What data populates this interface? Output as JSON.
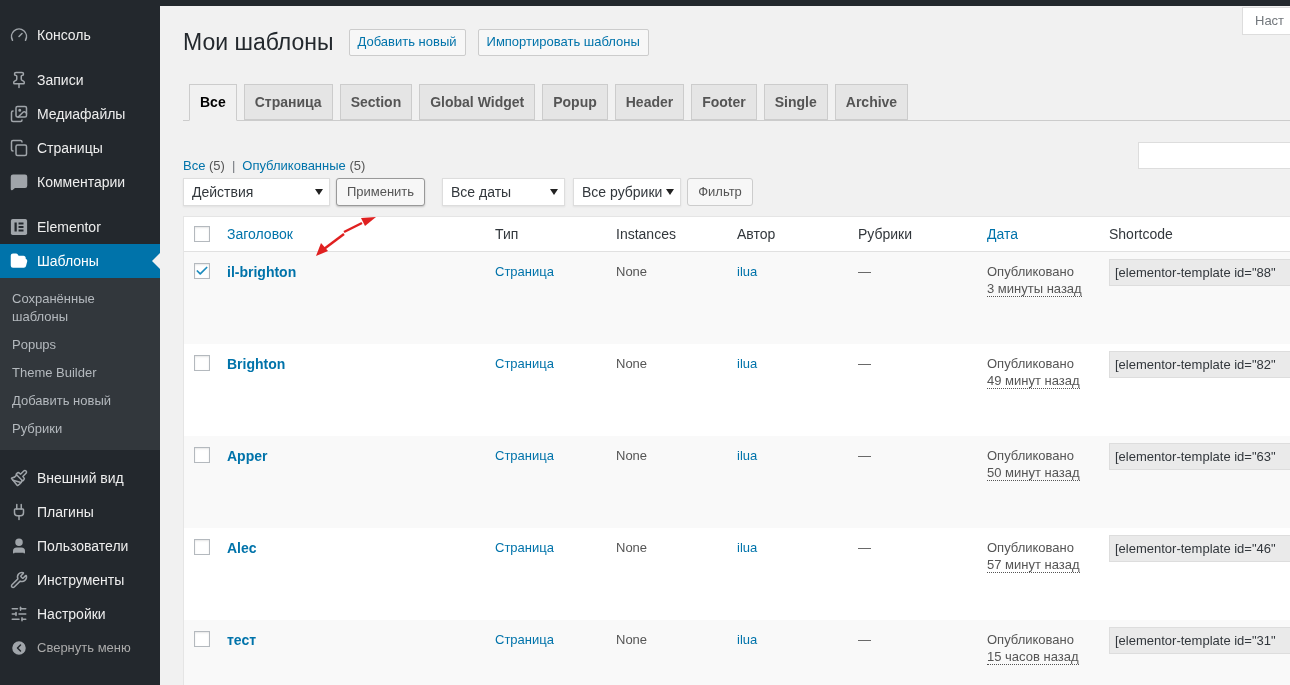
{
  "top_bar": {
    "screen_options": "Наст"
  },
  "sidebar": {
    "groups": [
      {
        "items": [
          {
            "label": "Консоль",
            "selected": false
          }
        ]
      },
      {
        "items": [
          {
            "label": "Записи",
            "selected": false
          },
          {
            "label": "Медиафайлы",
            "selected": false
          },
          {
            "label": "Страницы",
            "selected": false
          },
          {
            "label": "Комментарии",
            "selected": false
          }
        ]
      },
      {
        "items": [
          {
            "label": "Elementor",
            "selected": false
          },
          {
            "label": "Шаблоны",
            "selected": true,
            "children": [
              {
                "label": "Сохранённые шаблоны",
                "selected": false
              },
              {
                "label": "Popups",
                "selected": false
              },
              {
                "label": "Theme Builder",
                "selected": false
              },
              {
                "label": "Добавить новый",
                "selected": false
              },
              {
                "label": "Рубрики",
                "selected": false
              }
            ]
          }
        ]
      },
      {
        "items": [
          {
            "label": "Внешний вид",
            "selected": false
          },
          {
            "label": "Плагины",
            "selected": false
          },
          {
            "label": "Пользователи",
            "selected": false
          },
          {
            "label": "Инструменты",
            "selected": false
          },
          {
            "label": "Настройки",
            "selected": false
          }
        ]
      }
    ],
    "collapse": "Свернуть меню"
  },
  "page": {
    "title": "Мои шаблоны",
    "buttons": [
      "Добавить новый",
      "Импортировать шаблоны"
    ]
  },
  "tabs": [
    {
      "label": "Все",
      "selected": true
    },
    {
      "label": "Страница",
      "selected": false
    },
    {
      "label": "Section",
      "selected": false
    },
    {
      "label": "Global Widget",
      "selected": false
    },
    {
      "label": "Popup",
      "selected": false
    },
    {
      "label": "Header",
      "selected": false
    },
    {
      "label": "Footer",
      "selected": false
    },
    {
      "label": "Single",
      "selected": false
    },
    {
      "label": "Archive",
      "selected": false
    }
  ],
  "views": {
    "items": [
      {
        "label": "Все",
        "count": "(5)"
      },
      {
        "label": "Опубликованные",
        "count": "(5)"
      }
    ],
    "separator": "|"
  },
  "filters": {
    "bulk_action": "Действия",
    "apply": "Применить",
    "dates": "Все даты",
    "categories": "Все рубрики",
    "filter": "Фильтр"
  },
  "table": {
    "select_all_checked": false,
    "columns": [
      {
        "label": "Заголовок",
        "sortable": true
      },
      {
        "label": "Тип",
        "sortable": false
      },
      {
        "label": "Instances",
        "sortable": false
      },
      {
        "label": "Автор",
        "sortable": false
      },
      {
        "label": "Рубрики",
        "sortable": false
      },
      {
        "label": "Дата",
        "sortable": true
      },
      {
        "label": "Shortcode",
        "sortable": false
      }
    ],
    "rows": [
      {
        "checked": true,
        "title": "il-brighton",
        "type": "Страница",
        "instances": "None",
        "author": "ilua",
        "categories": "—",
        "status": "Опубликовано",
        "date": "3 минуты назад",
        "shortcode": "[elementor-template id=\"88\""
      },
      {
        "checked": false,
        "title": "Brighton",
        "type": "Страница",
        "instances": "None",
        "author": "ilua",
        "categories": "—",
        "status": "Опубликовано",
        "date": "49 минут назад",
        "shortcode": "[elementor-template id=\"82\""
      },
      {
        "checked": false,
        "title": "Apper",
        "type": "Страница",
        "instances": "None",
        "author": "ilua",
        "categories": "—",
        "status": "Опубликовано",
        "date": "50 минут назад",
        "shortcode": "[elementor-template id=\"63\""
      },
      {
        "checked": false,
        "title": "Alec",
        "type": "Страница",
        "instances": "None",
        "author": "ilua",
        "categories": "—",
        "status": "Опубликовано",
        "date": "57 минут назад",
        "shortcode": "[elementor-template id=\"46\""
      },
      {
        "checked": false,
        "title": "тест",
        "type": "Страница",
        "instances": "None",
        "author": "ilua",
        "categories": "—",
        "status": "Опубликовано",
        "date": "15 часов назад",
        "shortcode": "[elementor-template id=\"31\""
      }
    ]
  }
}
